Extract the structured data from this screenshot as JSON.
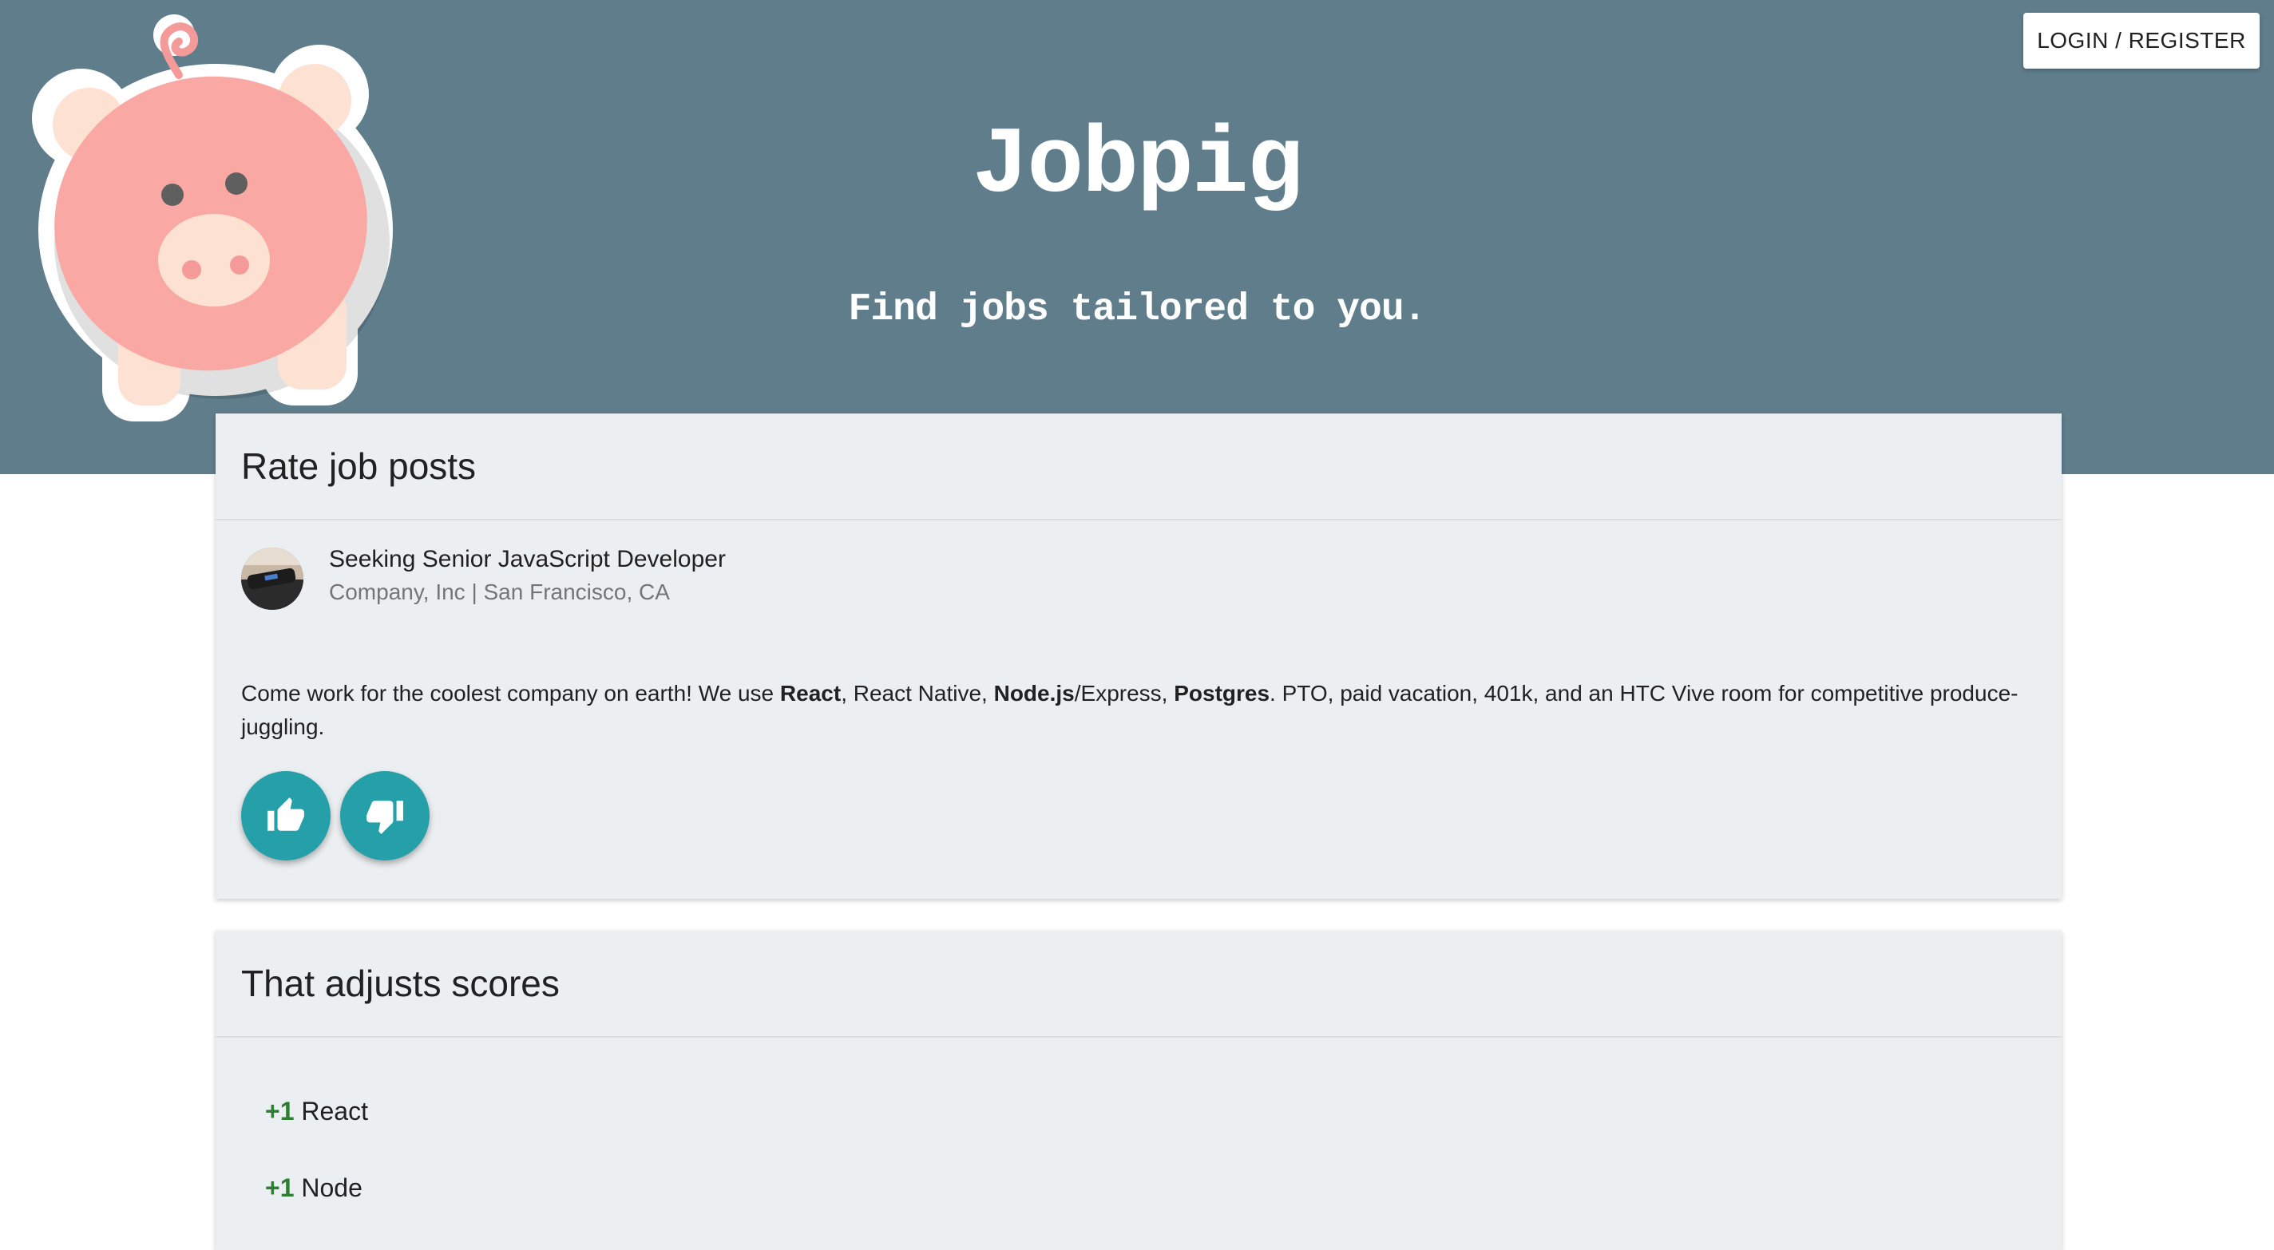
{
  "header": {
    "login_label": "LOGIN / REGISTER",
    "brand": "Jobpig",
    "tagline": "Find jobs tailored to you."
  },
  "rate_card": {
    "title": "Rate job posts",
    "post": {
      "title": "Seeking Senior JavaScript Developer",
      "company_location": "Company, Inc | San Francisco, CA",
      "description_parts": [
        {
          "text": "Come work for the coolest company on earth! We use ",
          "bold": false
        },
        {
          "text": "React",
          "bold": true
        },
        {
          "text": ", React Native, ",
          "bold": false
        },
        {
          "text": "Node.js",
          "bold": true
        },
        {
          "text": "/Express, ",
          "bold": false
        },
        {
          "text": "Postgres",
          "bold": true
        },
        {
          "text": ". PTO, paid vacation, 401k, and an HTC Vive room for competitive produce-juggling.",
          "bold": false
        }
      ]
    },
    "thumbs_up_icon": "thumb-up-icon",
    "thumbs_down_icon": "thumb-down-icon"
  },
  "scores_card": {
    "title": "That adjusts scores",
    "items": [
      {
        "delta": "+1",
        "label": "React"
      },
      {
        "delta": "+1",
        "label": "Node"
      }
    ]
  },
  "colors": {
    "hero_bg": "#607d8b",
    "card_bg": "#eceff1",
    "fab": "#26a0a8",
    "positive": "#2e7d32",
    "pig_body": "#f9a8a4",
    "pig_light": "#fde2d4"
  }
}
